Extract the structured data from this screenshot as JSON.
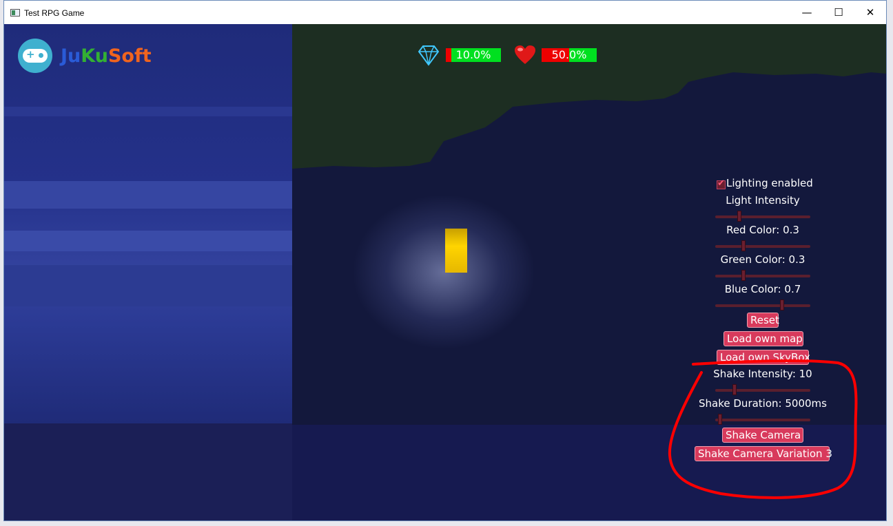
{
  "window": {
    "title": "Test RPG Game",
    "minimize": "—",
    "maximize": "☐",
    "close": "✕"
  },
  "logo": {
    "part1": "Ju",
    "part2": "Ku",
    "part3": "Soft",
    "color1": "#2a5bd7",
    "color2": "#33b033",
    "color3": "#f0641e"
  },
  "hud": {
    "mana": {
      "icon": "diamond-icon",
      "label": "10.0%",
      "value": 0.1
    },
    "health": {
      "icon": "heart-icon",
      "label": "50.0%",
      "value": 0.5
    }
  },
  "panel": {
    "lighting_label": "Lighting enabled",
    "lighting_checked": true,
    "light_intensity_label": "Light Intensity",
    "light_intensity_value": 0.25,
    "red_label": "Red Color: 0.3",
    "red_value": 0.3,
    "green_label": "Green Color: 0.3",
    "green_value": 0.3,
    "blue_label": "Blue Color: 0.7",
    "blue_value": 0.7,
    "reset_button": "Reset",
    "load_map_button": "Load own map",
    "load_skybox_button": "Load own SkyBox",
    "shake_intensity_label": "Shake Intensity: 10",
    "shake_intensity_value": 0.2,
    "shake_duration_label": "Shake Duration: 5000ms",
    "shake_duration_value": 0.05,
    "shake_camera_button": "Shake Camera",
    "shake_variation_button": "Shake Camera Variation 3"
  },
  "colors": {
    "button": "#d83a5c",
    "annotation": "#ff0000",
    "bar_red": "#ee0000",
    "bar_green": "#00e020"
  }
}
